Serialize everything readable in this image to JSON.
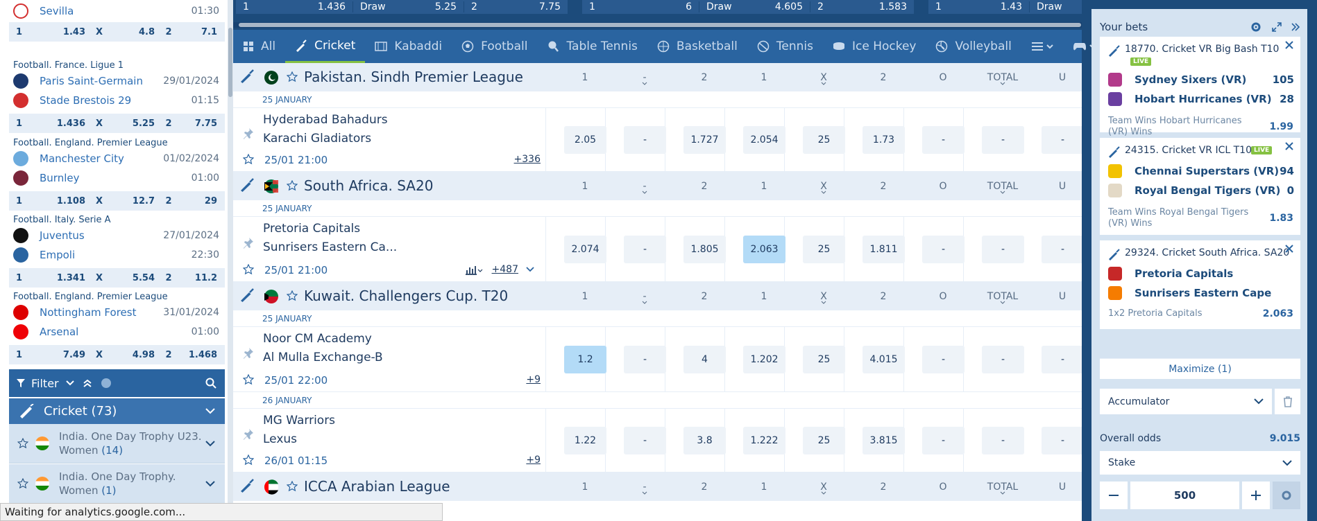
{
  "left": {
    "sevilla": {
      "team": "Sevilla",
      "time": "01:30",
      "odds": [
        "1",
        "1.43",
        "X",
        "4.8",
        "2",
        "7.1"
      ]
    },
    "matches": [
      {
        "league": "Football. France. Ligue 1",
        "home": "Paris Saint-Germain",
        "away": "Stade Brestois 29",
        "date": "29/01/2024",
        "time": "01:15",
        "odds": [
          "1",
          "1.436",
          "X",
          "5.25",
          "2",
          "7.75"
        ]
      },
      {
        "league": "Football. England. Premier League",
        "home": "Manchester City",
        "away": "Burnley",
        "date": "01/02/2024",
        "time": "01:00",
        "odds": [
          "1",
          "1.108",
          "X",
          "12.7",
          "2",
          "29"
        ]
      },
      {
        "league": "Football. Italy. Serie A",
        "home": "Juventus",
        "away": "Empoli",
        "date": "27/01/2024",
        "time": "22:30",
        "odds": [
          "1",
          "1.341",
          "X",
          "5.54",
          "2",
          "11.2"
        ]
      },
      {
        "league": "Football. England. Premier League",
        "home": "Nottingham Forest",
        "away": "Arsenal",
        "date": "31/01/2024",
        "time": "01:00",
        "odds": [
          "1",
          "7.49",
          "X",
          "4.98",
          "2",
          "1.468"
        ]
      }
    ],
    "filter_label": "Filter",
    "sport": "Cricket (73)",
    "leagues": [
      {
        "name": "India. One Day Trophy U23. Women",
        "count": "(14)"
      },
      {
        "name": "India. One Day Trophy. Women",
        "count": "(1)"
      }
    ]
  },
  "status": "Waiting for analytics.google.com...",
  "topstrip": [
    {
      "a": "1",
      "b": "1.436",
      "c": "Draw",
      "d": "5.25",
      "e": "2",
      "f": "7.75"
    },
    {
      "a": "1",
      "b": "6",
      "c": "Draw",
      "d": "4.605",
      "e": "2",
      "f": "1.583"
    },
    {
      "a": "1",
      "b": "1.43",
      "c": "Draw",
      "d": "",
      "e": "",
      "f": ""
    }
  ],
  "tabs": [
    "All",
    "Cricket",
    "Kabaddi",
    "Football",
    "Table Tennis",
    "Basketball",
    "Tennis",
    "Ice Hockey",
    "Volleyball"
  ],
  "colheads": [
    "1",
    "-",
    "2",
    "1",
    "X",
    "2",
    "O",
    "TOTAL",
    "U"
  ],
  "sections": [
    {
      "league": "Pakistan. Sindh Premier League",
      "date": "25 JANUARY",
      "event": {
        "home": "Hyderabad Bahadurs",
        "away": "Karachi Gladiators",
        "time": "25/01 21:00",
        "more": "+336",
        "odds": [
          "2.05",
          "-",
          "1.727",
          "2.054",
          "25",
          "1.73",
          "-",
          "-",
          "-"
        ]
      }
    },
    {
      "league": "South Africa. SA20",
      "date": "25 JANUARY",
      "event": {
        "home": "Pretoria Capitals",
        "away": "Sunrisers Eastern Ca...",
        "time": "25/01 21:00",
        "more": "+487",
        "odds": [
          "2.074",
          "-",
          "1.805",
          "2.063",
          "25",
          "1.811",
          "-",
          "-",
          "-"
        ]
      }
    },
    {
      "league": "Kuwait. Challengers Cup. T20",
      "date": "25 JANUARY",
      "event": {
        "home": "Noor CM Academy",
        "away": "Al Mulla Exchange-B",
        "time": "25/01 22:00",
        "more": "+9",
        "odds": [
          "1.2",
          "-",
          "4",
          "1.202",
          "25",
          "4.015",
          "-",
          "-",
          "-"
        ]
      }
    },
    {
      "date": "26 JANUARY",
      "event": {
        "home": "MG Warriors",
        "away": "Lexus",
        "time": "26/01 01:15",
        "more": "+9",
        "odds": [
          "1.22",
          "-",
          "3.8",
          "1.222",
          "25",
          "3.815",
          "-",
          "-",
          "-"
        ]
      }
    },
    {
      "league": "ICCA Arabian League"
    }
  ],
  "betslip": {
    "title": "Your bets",
    "bets": [
      {
        "title": "18770. Cricket VR Big Bash T10",
        "live": "LIVE",
        "team1": "Sydney Sixers (VR)",
        "s1": "105",
        "team2": "Hobart Hurricanes (VR)",
        "s2": "28",
        "desc": "Team Wins Hobart Hurricanes (VR) Wins",
        "odd": "1.99"
      },
      {
        "title": "24315. Cricket VR ICL T10",
        "live": "LIVE",
        "team1": "Chennai Superstars (VR)",
        "s1": "94",
        "team2": "Royal Bengal Tigers (VR)",
        "s2": "0",
        "desc": "Team Wins Royal Bengal Tigers (VR) Wins",
        "odd": "1.83"
      },
      {
        "title": "29324. Cricket South Africa. SA20",
        "team1": "Pretoria Capitals",
        "team2": "Sunrisers Eastern Cape",
        "desc": "1x2 Pretoria Capitals",
        "odd": "2.063"
      }
    ],
    "maximize": "Maximize (1)",
    "type": "Accumulator",
    "overall_label": "Overall odds",
    "overall": "9.015",
    "stake_label": "Stake",
    "stake_value": "500"
  },
  "colors": {
    "brand": "#1c4b7b",
    "accent": "#85c142",
    "selected": "#b3dbf7"
  }
}
